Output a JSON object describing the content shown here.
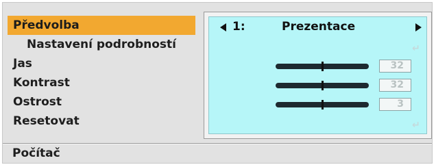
{
  "menu": {
    "items": [
      {
        "label": "Předvolba"
      },
      {
        "label": "Nastavení podrobností"
      },
      {
        "label": "Jas"
      },
      {
        "label": "Kontrast"
      },
      {
        "label": "Ostrost"
      },
      {
        "label": "Resetovat"
      }
    ]
  },
  "panel": {
    "preset_number": "1:",
    "preset_name": "Prezentace",
    "enter_glyph": "↵",
    "settings": {
      "brightness": {
        "value": "32",
        "level": 0.5
      },
      "contrast": {
        "value": "32",
        "level": 0.5
      },
      "sharpness": {
        "value": "3",
        "level": 0.5
      }
    }
  },
  "footer": {
    "label": "Počítač"
  },
  "icons": {
    "prev": "triangle-left-icon",
    "next": "triangle-right-icon",
    "enter": "enter-icon"
  }
}
